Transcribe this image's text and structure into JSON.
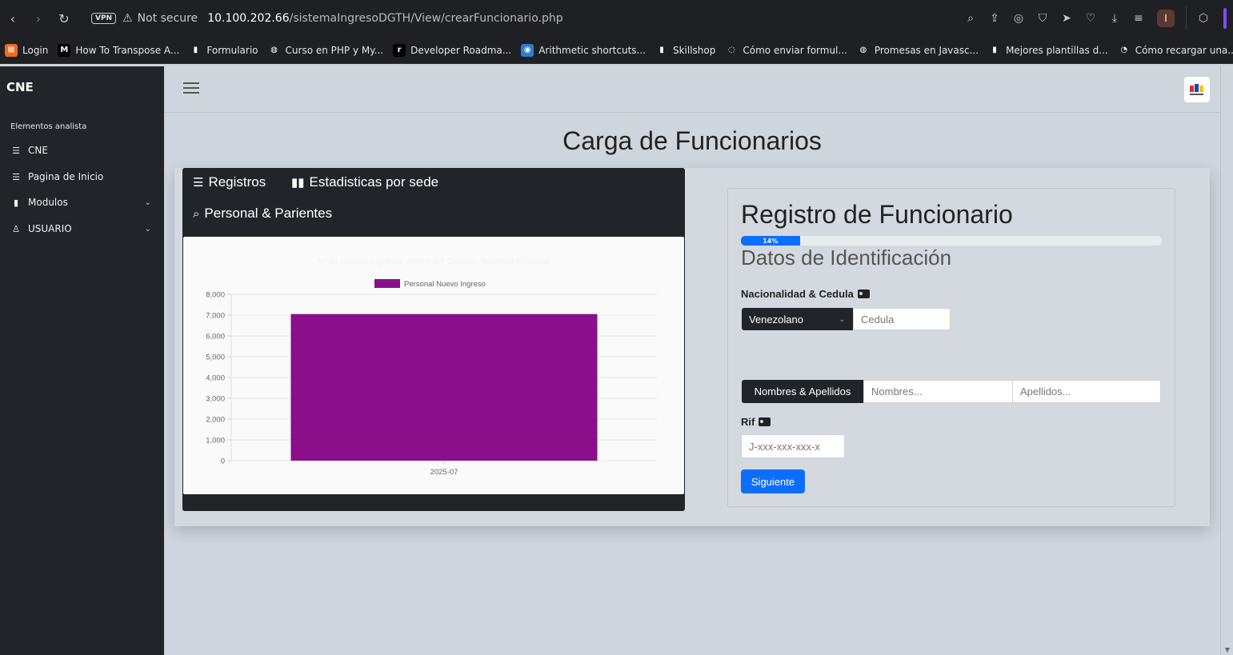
{
  "browser": {
    "vpn_label": "VPN",
    "not_secure": "Not secure",
    "url_host": "10.100.202.66",
    "url_path": "/sistemaIngresoDGTH/View/crearFuncionario.php",
    "profile_initial": "I"
  },
  "bookmarks": [
    {
      "label": "Login",
      "icon": "xampp-icon",
      "color": "#f06a20",
      "glyph": "⊠"
    },
    {
      "label": "How To Transpose A...",
      "icon": "medium-icon",
      "color": "#000000",
      "glyph": "M"
    },
    {
      "label": "Formulario",
      "icon": "document-icon",
      "color": "#1f2023",
      "glyph": "▮"
    },
    {
      "label": "Curso en PHP y My...",
      "icon": "globe-icon",
      "color": "#1f2023",
      "glyph": "◍"
    },
    {
      "label": "Developer Roadma...",
      "icon": "roadmap-icon",
      "color": "#000000",
      "glyph": "r"
    },
    {
      "label": "Arithmetic shortcuts...",
      "icon": "robot-icon",
      "color": "#2a7fd4",
      "glyph": "◉"
    },
    {
      "label": "Skillshop",
      "icon": "document-icon",
      "color": "#1f2023",
      "glyph": "▮"
    },
    {
      "label": "Cómo enviar formul...",
      "icon": "digitalocean-icon",
      "color": "#1f2023",
      "glyph": "◌"
    },
    {
      "label": "Promesas en Javasc...",
      "icon": "globe-icon",
      "color": "#1f2023",
      "glyph": "◍"
    },
    {
      "label": "Mejores plantillas d...",
      "icon": "document-icon",
      "color": "#1f2023",
      "glyph": "▮"
    },
    {
      "label": "Cómo recargar una...",
      "icon": "pie-icon",
      "color": "#1f2023",
      "glyph": "◔"
    }
  ],
  "sidebar": {
    "brand": "CNE",
    "section_title": "Elementos analista",
    "items": [
      {
        "label": "CNE",
        "icon": "list-icon"
      },
      {
        "label": "Pagina de Inicio",
        "icon": "list-icon"
      },
      {
        "label": "Modulos",
        "icon": "file-icon",
        "expandable": true
      },
      {
        "label": "USUARIO",
        "icon": "user-icon",
        "expandable": true
      }
    ]
  },
  "page": {
    "title": "Carga de Funcionarios"
  },
  "tabs": [
    {
      "label": "Registros",
      "icon": "list-icon"
    },
    {
      "label": "Estadisticas por sede",
      "icon": "bar-chart-icon"
    },
    {
      "label": "Personal & Parientes",
      "icon": "search-chart-icon"
    }
  ],
  "chart_data": {
    "type": "bar",
    "title": "N° de nuevos ingresos dentro del Consejo Nacional Electoral",
    "categories": [
      "2025-07"
    ],
    "series": [
      {
        "name": "Personal Nuevo Ingreso",
        "values": [
          7050
        ],
        "color": "#8b0f8b"
      }
    ],
    "ylim": [
      0,
      8000
    ],
    "yticks": [
      0,
      1000,
      2000,
      3000,
      4000,
      5000,
      6000,
      7000,
      8000
    ],
    "legend": "top",
    "grid": true
  },
  "form": {
    "title": "Registro de Funcionario",
    "progress_percent": 14,
    "progress_label": "14%",
    "section": "Datos de Identificación",
    "nacionalidad_label": "Nacionalidad & Cedula",
    "nacionalidad_value": "Venezolano",
    "cedula_placeholder": "Cedula",
    "nombres_addon": "Nombres & Apellidos",
    "nombres_placeholder": "Nombres...",
    "apellidos_placeholder": "Apellidos...",
    "rif_label": "Rif",
    "rif_placeholder": "J-xxx-xxx-xxx-x",
    "next_button": "Siguiente"
  }
}
